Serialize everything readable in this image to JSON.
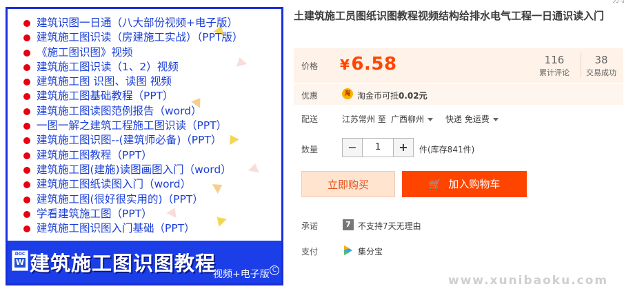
{
  "image": {
    "items": [
      "建筑识图一日通（八大部份视频+电子版）",
      "建筑施工图识读（房建施工实战）（PPT版）",
      "《施工图识图》视频",
      "建筑施工图识读（1、2）视频",
      "建筑施工图 识图、读图 视频",
      "建筑施工图基础教程（PPT）",
      "建筑施工图读图范例报告（word）",
      "一图一解之建筑工程施工图识读（PPT）",
      "建筑施工图识图--(建筑师必备)（PPT）",
      "建筑施工图教程（PPT）",
      "建筑施工图(建施)读图画图入门（word）",
      "建筑施工图纸读图入门（word）",
      "建筑施工图(很好很实用的)（PPT）",
      "学看建筑施工图（PPT）",
      "建筑施工图识图入门基础（PPT）"
    ],
    "doc_tag": "DOC",
    "doc_letter": "W",
    "banner_title": "建筑施工图识图教程",
    "banner_sub": "视频+电子版",
    "circle_mark": "C",
    "colors": {
      "border": "#1a2fd8",
      "list_text": "#1b3fd6",
      "bullet": "#e60012",
      "banner_bg": "#1b3ee8"
    }
  },
  "product": {
    "title": "土建筑施工员图纸识图教程视频结构给排水电气工程一日通识读入门",
    "price_label": "价格",
    "currency": "¥",
    "price": "6.58",
    "reviews_count": "116",
    "reviews_label": "累计评论",
    "sales_count": "38",
    "sales_label": "交易成功",
    "promo_label": "优惠",
    "promo_coin": "淘",
    "promo_text_pre": "淘金币可抵",
    "promo_amount": "0.02元",
    "shipping_label": "配送",
    "ship_from": "江苏常州 至",
    "ship_to": "广西柳州",
    "ship_method": "快递 免运费",
    "qty_label": "数量",
    "qty_minus": "−",
    "qty_value": "1",
    "qty_plus": "+",
    "stock_text": "件(库存841件)",
    "buy_now": "立即购买",
    "cart_glyph": "🛒",
    "add_cart": "加入购物车",
    "promise_label": "承诺",
    "promise_badge": "7",
    "promise_text": "不支持7天无理由",
    "pay_label": "支付",
    "pay_text": "集分宝",
    "colors": {
      "price": "#ff4400",
      "cart_button": "#ff4400",
      "buy_button_bg": "#ffe4d0",
      "price_bg": "#fff2e8"
    }
  },
  "watermark": "www.xunibaoku.com",
  "corner_text": "分享"
}
